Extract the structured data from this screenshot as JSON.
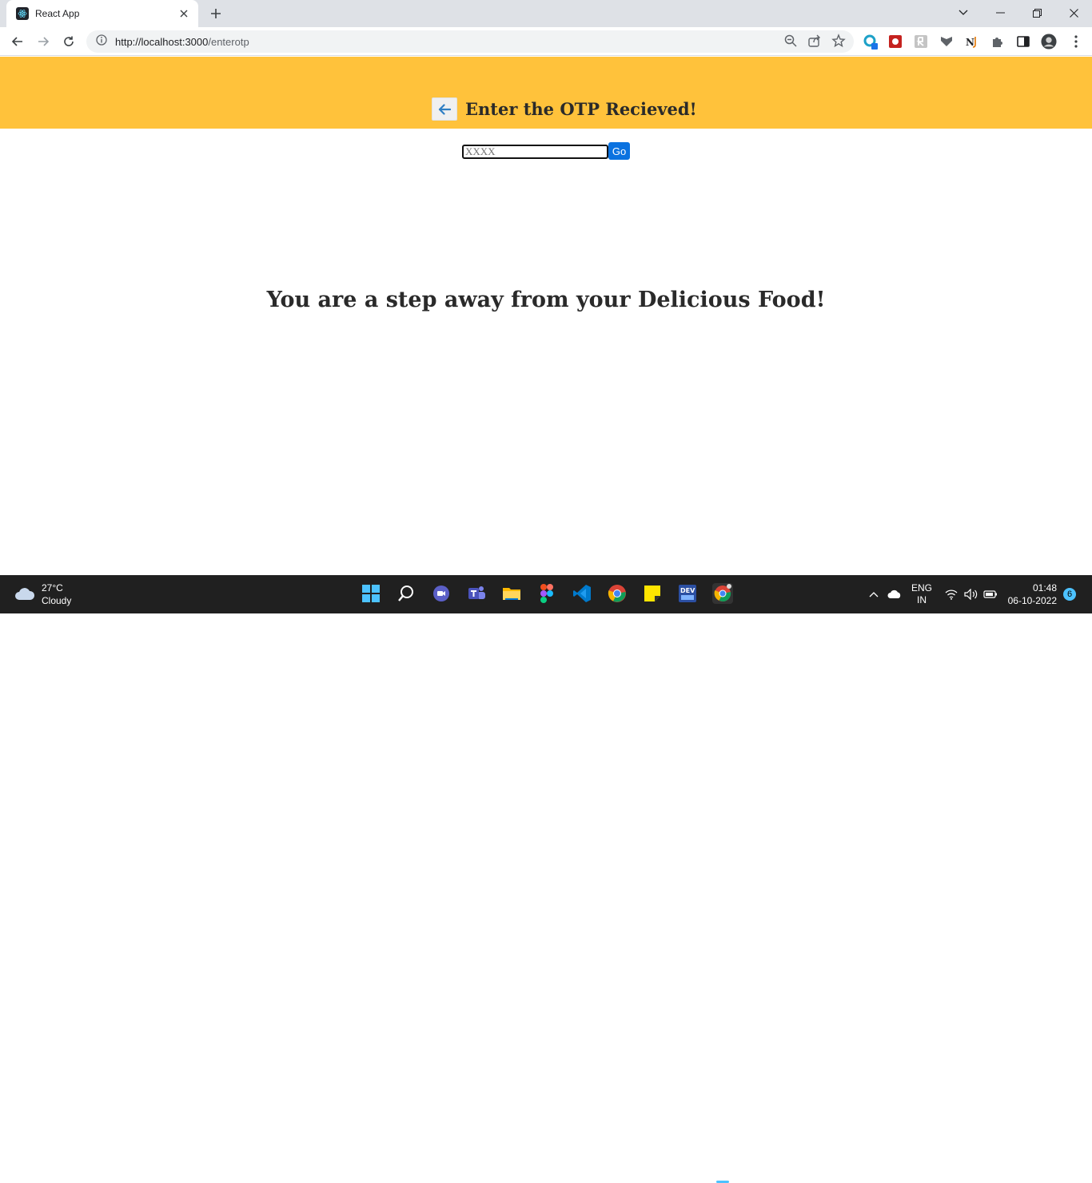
{
  "browser": {
    "tab_title": "React App",
    "url_host": "http://localhost:3000",
    "url_path": "/enterotp"
  },
  "header": {
    "title": "Enter the OTP Recieved!"
  },
  "otp": {
    "placeholder": "XXXX",
    "go_label": "Go"
  },
  "main": {
    "tagline": "You are a step away from your Delicious Food!"
  },
  "taskbar": {
    "weather_temp": "27°C",
    "weather_desc": "Cloudy",
    "lang_top": "ENG",
    "lang_bottom": "IN",
    "time": "01:48",
    "date": "06-10-2022",
    "notification_count": "6"
  },
  "colors": {
    "header_bg": "#ffc23b",
    "accent": "#0a72e0"
  }
}
